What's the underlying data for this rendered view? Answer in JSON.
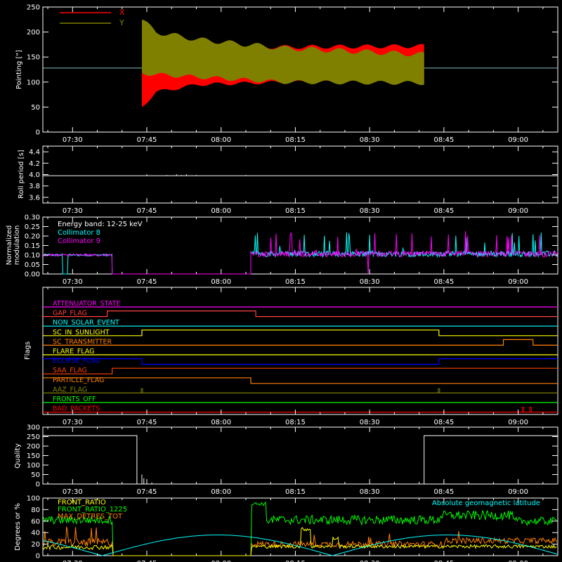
{
  "time_ticks": [
    "07:30",
    "07:45",
    "08:00",
    "08:15",
    "08:30",
    "08:45",
    "09:00"
  ],
  "chart_data": [
    {
      "type": "area",
      "name": "pointing",
      "ylabel": "Pointing [\"]",
      "xlim": [
        "07:24",
        "09:08"
      ],
      "ylim": [
        0,
        250
      ],
      "yticks": [
        0,
        50,
        100,
        150,
        200,
        250
      ],
      "legend": {
        "placement": "top-left",
        "entries": [
          "X",
          "Y"
        ]
      },
      "baseline": 128,
      "series": [
        {
          "name": "X",
          "color": "#ff0000",
          "start": "07:44",
          "end": "08:41",
          "upper": [
            [
              0,
              162
            ],
            [
              0.05,
              175
            ],
            [
              0.2,
              172
            ],
            [
              0.5,
              170
            ],
            [
              1,
              172
            ]
          ],
          "lower": [
            [
              0,
              50
            ],
            [
              0.05,
              80
            ],
            [
              0.2,
              95
            ],
            [
              0.5,
              100
            ],
            [
              1,
              100
            ]
          ]
        },
        {
          "name": "Y",
          "color": "#808000",
          "start": "07:44",
          "end": "08:41",
          "upper": [
            [
              0,
              225
            ],
            [
              0.05,
              200
            ],
            [
              0.2,
              185
            ],
            [
              0.5,
              168
            ],
            [
              1,
              155
            ]
          ],
          "lower": [
            [
              0,
              118
            ],
            [
              0.05,
              115
            ],
            [
              0.2,
              110
            ],
            [
              0.5,
              100
            ],
            [
              1,
              98
            ]
          ]
        }
      ]
    },
    {
      "type": "line",
      "name": "roll-period",
      "ylabel": "Roll period [s]",
      "ylim": [
        3.5,
        4.5
      ],
      "yticks": [
        "3.6",
        "3.8",
        "4.0",
        "4.2",
        "4.4"
      ],
      "series": [
        {
          "name": "roll",
          "color": "#ffffff",
          "value": 3.98
        }
      ]
    },
    {
      "type": "line",
      "name": "modulation",
      "ylabel": "Normalized modulation",
      "ylim": [
        0,
        0.3
      ],
      "yticks": [
        "0.00",
        "0.05",
        "0.10",
        "0.15",
        "0.20",
        "0.25",
        "0.30"
      ],
      "legend": {
        "placement": "top-left",
        "entries": [
          "Energy band: 12-25 keV",
          "Collimator 8",
          "Collimator 9"
        ]
      },
      "series": [
        {
          "name": "Collimator 8",
          "color": "#00ffff",
          "level": 0.1,
          "gap": [
            "07:38",
            "08:06"
          ]
        },
        {
          "name": "Collimator 9",
          "color": "#ff00ff",
          "level": 0.1,
          "gap": [
            "07:38",
            "08:06"
          ]
        }
      ]
    },
    {
      "type": "line",
      "name": "flags",
      "ylabel": "Flags",
      "flags": [
        {
          "label": "ATTENUATOR_STATE",
          "color": "#ff00ff",
          "steps": []
        },
        {
          "label": "GAP_FLAG",
          "color": "#ff4040",
          "steps": [
            [
              "07:24",
              0
            ],
            [
              "07:37",
              1
            ],
            [
              "08:07",
              0
            ]
          ]
        },
        {
          "label": "NON_SOLAR_EVENT",
          "color": "#00ffff",
          "steps": []
        },
        {
          "label": "SC_IN_SUNLIGHT",
          "color": "#ffff00",
          "steps": [
            [
              "07:24",
              0
            ],
            [
              "07:44",
              1
            ],
            [
              "08:44",
              0
            ]
          ]
        },
        {
          "label": "SC_TRANSMITTER",
          "color": "#ff8000",
          "steps": [
            [
              "07:24",
              0
            ],
            [
              "08:57",
              1
            ],
            [
              "09:03",
              0
            ]
          ]
        },
        {
          "label": "FLARE_FLAG",
          "color": "#ffff00",
          "steps": []
        },
        {
          "label": "ECLIPSE_FLAG",
          "color": "#0000ff",
          "steps": [
            [
              "07:24",
              1
            ],
            [
              "07:44",
              0
            ],
            [
              "08:44",
              1
            ]
          ]
        },
        {
          "label": "SAA_FLAG",
          "color": "#ff4000",
          "steps": [
            [
              "07:24",
              0
            ],
            [
              "07:38",
              1
            ]
          ]
        },
        {
          "label": "PARTICLE_FLAG",
          "color": "#ff8000",
          "steps": [
            [
              "07:24",
              1
            ],
            [
              "08:06",
              0
            ]
          ]
        },
        {
          "label": "AAZ_FLAG",
          "color": "#808000",
          "steps": []
        },
        {
          "label": "FRONTS_OFF",
          "color": "#00ff00",
          "steps": []
        },
        {
          "label": "BAD_PACKETS",
          "color": "#ff0000",
          "steps": []
        }
      ]
    },
    {
      "type": "line",
      "name": "quality",
      "ylabel": "Quality",
      "ylim": [
        0,
        300
      ],
      "yticks": [
        0,
        50,
        100,
        150,
        200,
        250,
        300
      ],
      "series": [
        {
          "name": "quality",
          "color": "#ffffff",
          "points": [
            [
              "07:24",
              255
            ],
            [
              "07:43",
              255
            ],
            [
              "07:43",
              0
            ],
            [
              "08:41",
              0
            ],
            [
              "08:41",
              255
            ],
            [
              "09:08",
              255
            ]
          ]
        }
      ]
    },
    {
      "type": "line",
      "name": "ratios",
      "ylabel": "Degrees or %",
      "ylim": [
        0,
        100
      ],
      "yticks": [
        0,
        20,
        40,
        60,
        80,
        100
      ],
      "legend": {
        "placement": "top-left",
        "entries": [
          "FRONT_RATIO",
          "FRONT_RATIO_1225",
          "MAX_DETRES_TOT"
        ]
      },
      "annotation": "Absolute geomagnetic latitude",
      "series": [
        {
          "name": "FRONT_RATIO",
          "color": "#ffff00"
        },
        {
          "name": "FRONT_RATIO_1225",
          "color": "#00ff00"
        },
        {
          "name": "MAX_DETRES_TOT",
          "color": "#ff8000"
        },
        {
          "name": "Absolute geomagnetic latitude",
          "color": "#00ffff"
        }
      ]
    }
  ],
  "labels": {
    "pointing_ylabel": "Pointing [\"]",
    "pointing_X": "X",
    "pointing_Y": "Y",
    "roll_ylabel": "Roll period [s]",
    "mod_ylabel1": "Normalized",
    "mod_ylabel2": "modulation",
    "mod_leg0": "Energy band: 12-25 keV",
    "mod_leg1": "Collimator 8",
    "mod_leg2": "Collimator 9",
    "flags_ylabel": "Flags",
    "quality_ylabel": "Quality",
    "ratio_ylabel": "Degrees or %",
    "ratio_leg0": "FRONT_RATIO",
    "ratio_leg1": "FRONT_RATIO_1225",
    "ratio_leg2": "MAX_DETRES_TOT",
    "ratio_annot": "Absolute geomagnetic latitude"
  }
}
